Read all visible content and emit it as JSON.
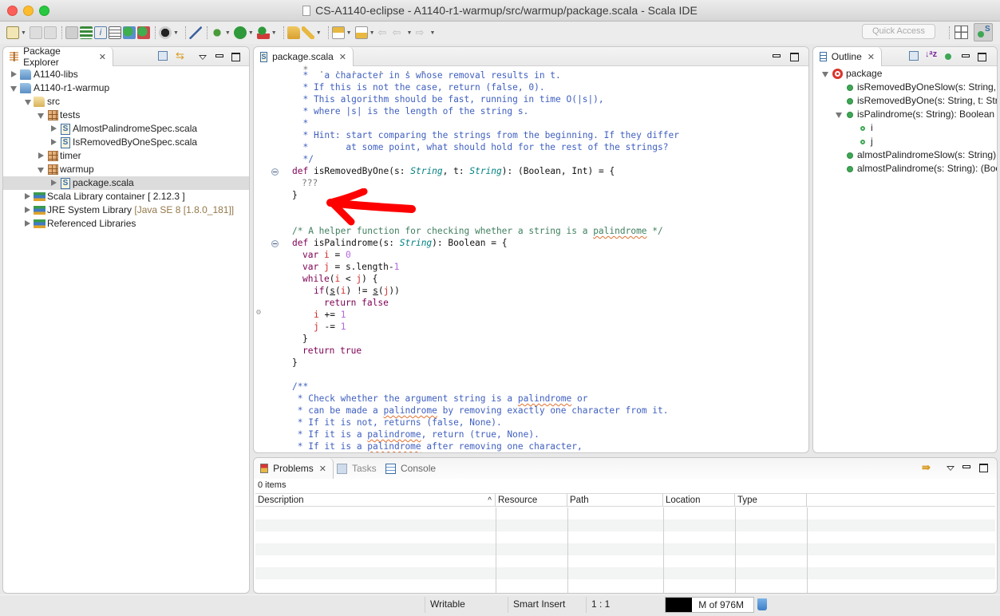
{
  "window": {
    "title": "CS-A1140-eclipse - A1140-r1-warmup/src/warmup/package.scala - Scala IDE"
  },
  "toolbar": {
    "quick_access_placeholder": "Quick Access",
    "buttons": [
      "new-icon",
      "save-icon",
      "save-all-icon",
      "toggle-link-icon",
      "outline-icon",
      "info-icon",
      "doc-icon",
      "run-scala-icon",
      "run-test-icon",
      "profile-icon",
      "pin-icon",
      "debug-icon",
      "run-icon",
      "external-tools-icon",
      "open-project-icon",
      "pen-icon",
      "next-annotation-icon",
      "prev-annotation-icon",
      "last-edit-icon",
      "back-icon",
      "forward-icon"
    ]
  },
  "package_explorer": {
    "tab_label": "Package Explorer",
    "tree": [
      {
        "label": "A1140-libs",
        "icon": "project-icon",
        "depth": 0,
        "expanded": false
      },
      {
        "label": "A1140-r1-warmup",
        "icon": "project-icon",
        "depth": 0,
        "expanded": true
      },
      {
        "label": "src",
        "icon": "source-folder-icon",
        "depth": 1,
        "expanded": true
      },
      {
        "label": "tests",
        "icon": "package-icon",
        "depth": 2,
        "expanded": true
      },
      {
        "label": "AlmostPalindromeSpec.scala",
        "icon": "scala-file-icon",
        "depth": 3,
        "expanded": false
      },
      {
        "label": "IsRemovedByOneSpec.scala",
        "icon": "scala-file-icon",
        "depth": 3,
        "expanded": false
      },
      {
        "label": "timer",
        "icon": "package-icon",
        "depth": 2,
        "expanded": false
      },
      {
        "label": "warmup",
        "icon": "package-icon",
        "depth": 2,
        "expanded": true
      },
      {
        "label": "package.scala",
        "icon": "scala-file-icon",
        "depth": 3,
        "expanded": false,
        "selected": true
      },
      {
        "label": "Scala Library container [ 2.12.3 ]",
        "icon": "library-icon",
        "depth": 1,
        "expanded": false
      },
      {
        "label": "JRE System Library",
        "decoration": "[Java SE 8 [1.8.0_181]]",
        "icon": "library-icon",
        "depth": 1,
        "expanded": false
      },
      {
        "label": "Referenced Libraries",
        "icon": "library-icon",
        "depth": 1,
        "expanded": false
      }
    ]
  },
  "editor": {
    "tab_label": "package.scala",
    "lines": {
      "l1": "  *   a character in s whose removal results in t.",
      "l2": "  * If this is not the case, return (false, 0).",
      "l3": "  * This algorithm should be fast, running in time O(|s|),",
      "l4": "  * where |s| is the length of the string s.",
      "l5": "  *",
      "l6": "  * Hint: start comparing the strings from the beginning. If they differ",
      "l7": "  *       at some point, what should hold for the rest of the strings?",
      "l8": "  */",
      "l14": "/* A helper function for checking whether a string is a ",
      "l14b": "palindrome",
      "l14c": " */",
      "l25": "/**",
      "l26a": " * Check whether the argument string is a ",
      "l26b": "palindrome",
      "l26c": " or",
      "l27a": " * can be made a ",
      "l27b": "palindrome",
      "l27c": " by removing exactly one character from it.",
      "l28": " * If it is not, returns (false, None).",
      "l29a": " * If it is a ",
      "l29b": "palindrome",
      "l29c": ", return (true, None).",
      "l30a": " * If it is a ",
      "l30b": "palindrome",
      "l30c": " after removing one character,"
    },
    "code": {
      "def": "def",
      "fn1": " isRemovedByOne(",
      "s": "s",
      "colon": ": ",
      "String": "String",
      "comma_t": ", t: ",
      "ret1": "): (Boolean, Int) = {",
      "todo": "???",
      "close": "}",
      "fn2": " isPalindrome(",
      "ret2": "): Boolean = {",
      "var": "var",
      "i": "i",
      "j": "j",
      "eq": " = ",
      "zero": "0",
      "one": "1",
      "slen": "s.length-",
      "while": "while",
      "lt": " < ",
      "if": "if",
      "neq": ") != ",
      "return": "return",
      "false": "false",
      "true": "true",
      "pluseq": " += ",
      "minuseq": " -= "
    },
    "annotation_color": "#ff0000"
  },
  "outline": {
    "tab_label": "Outline",
    "root": "package",
    "items": [
      {
        "label": "isRemovedByOneSlow(s: String, t",
        "depth": 1
      },
      {
        "label": "isRemovedByOne(s: String, t: Stri",
        "depth": 1
      },
      {
        "label": "isPalindrome(s: String): Boolean",
        "depth": 1,
        "expanded": true
      },
      {
        "label": "i",
        "depth": 2
      },
      {
        "label": "j",
        "depth": 2
      },
      {
        "label": "almostPalindromeSlow(s: String):",
        "depth": 1
      },
      {
        "label": "almostPalindrome(s: String): (Boo",
        "depth": 1
      }
    ]
  },
  "problems": {
    "tabs": [
      {
        "label": "Problems",
        "active": true
      },
      {
        "label": "Tasks",
        "active": false
      },
      {
        "label": "Console",
        "active": false
      }
    ],
    "count": "0 items",
    "columns": [
      "Description",
      "Resource",
      "Path",
      "Location",
      "Type"
    ],
    "sort_indicator": "^",
    "rows": []
  },
  "status_bar": {
    "writable": "Writable",
    "insert_mode": "Smart Insert",
    "position": "1 : 1",
    "heap": "M of 976M",
    "heap_used_fraction": 0.3
  }
}
